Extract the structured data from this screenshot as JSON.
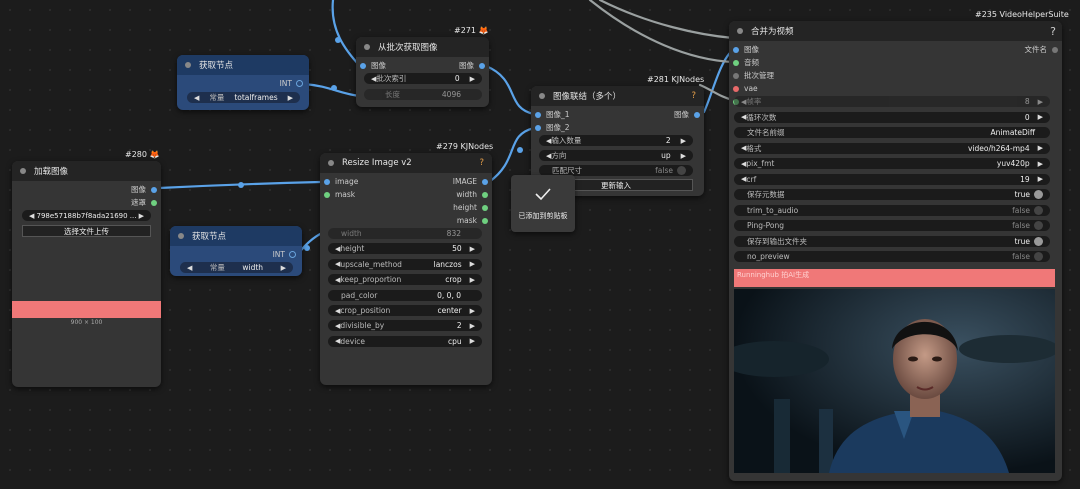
{
  "node_gettotal": {
    "title": "获取节点",
    "out": "INT",
    "widget_label": "常量",
    "widget_value": "totalframes"
  },
  "node_getwidth": {
    "title": "获取节点",
    "out": "INT",
    "widget_label": "常量",
    "widget_value": "width"
  },
  "node271": {
    "tag_id": "#271",
    "title": "从批次获取图像",
    "in_image": "图像",
    "out_image": "图像",
    "w_index_label": "批次索引",
    "w_index_value": "0",
    "w_len_label": "长度",
    "w_len_value": "4096"
  },
  "node280": {
    "tag_id": "#280",
    "title": "加载图像",
    "out_image": "图像",
    "out_mask": "遮罩",
    "file_value": "798e57188b7f8ada21690 ...",
    "upload_label": "选择文件上传",
    "size_text": "900 × 100"
  },
  "node279": {
    "tag_id": "#279 KJNodes",
    "title": "Resize Image v2",
    "in_image": "image",
    "in_mask": "mask",
    "out_image": "IMAGE",
    "out_width": "width",
    "out_height": "height",
    "out_mask": "mask",
    "widgets": [
      {
        "label": "width",
        "value": "832",
        "dim": true
      },
      {
        "label": "height",
        "value": "50"
      },
      {
        "label": "upscale_method",
        "value": "lanczos"
      },
      {
        "label": "keep_proportion",
        "value": "crop"
      },
      {
        "label": "pad_color",
        "value": "0, 0, 0"
      },
      {
        "label": "crop_position",
        "value": "center"
      },
      {
        "label": "divisible_by",
        "value": "2"
      },
      {
        "label": "device",
        "value": "cpu"
      }
    ]
  },
  "node281": {
    "tag_id": "#281 KJNodes",
    "title": "图像联结（多个）",
    "in1": "图像_1",
    "in2": "图像_2",
    "out": "图像",
    "w_count_label": "输入数量",
    "w_count_value": "2",
    "w_dir_label": "方向",
    "w_dir_value": "up",
    "w_match_label": "匹配尺寸",
    "w_match_value": "false",
    "update_btn": "更新输入"
  },
  "node235": {
    "tag_id": "#235 VideoHelperSuite",
    "title": "合并为视频",
    "help": "?",
    "in_image": "图像",
    "in_audio": "音频",
    "in_batch": "批次管理",
    "in_vae": "vae",
    "out_filenames": "文件名",
    "widgets": [
      {
        "label": "帧率",
        "value": "8",
        "dim": true,
        "type": "num"
      },
      {
        "label": "循环次数",
        "value": "0",
        "type": "num"
      },
      {
        "label": "文件名前缀",
        "value": "AnimateDiff",
        "type": "text"
      },
      {
        "label": "格式",
        "value": "video/h264-mp4",
        "type": "combo"
      },
      {
        "label": "pix_fmt",
        "value": "yuv420p",
        "type": "combo"
      },
      {
        "label": "crf",
        "value": "19",
        "type": "num"
      },
      {
        "label": "保存元数据",
        "value": "true",
        "type": "toggle"
      },
      {
        "label": "trim_to_audio",
        "value": "false",
        "type": "toggle"
      },
      {
        "label": "Ping-Pong",
        "value": "false",
        "type": "toggle"
      },
      {
        "label": "保存到输出文件夹",
        "value": "true",
        "type": "toggle"
      },
      {
        "label": "no_preview",
        "value": "false",
        "type": "toggle"
      }
    ],
    "banner_text": "Runninghub 拍AI生成"
  },
  "toast": {
    "text": "已添加到剪贴板",
    "icon": "check-icon"
  },
  "colors": {
    "accent_link": "#5aa2e8",
    "link_grey": "#9aa0a0",
    "banner": "#f07878"
  }
}
